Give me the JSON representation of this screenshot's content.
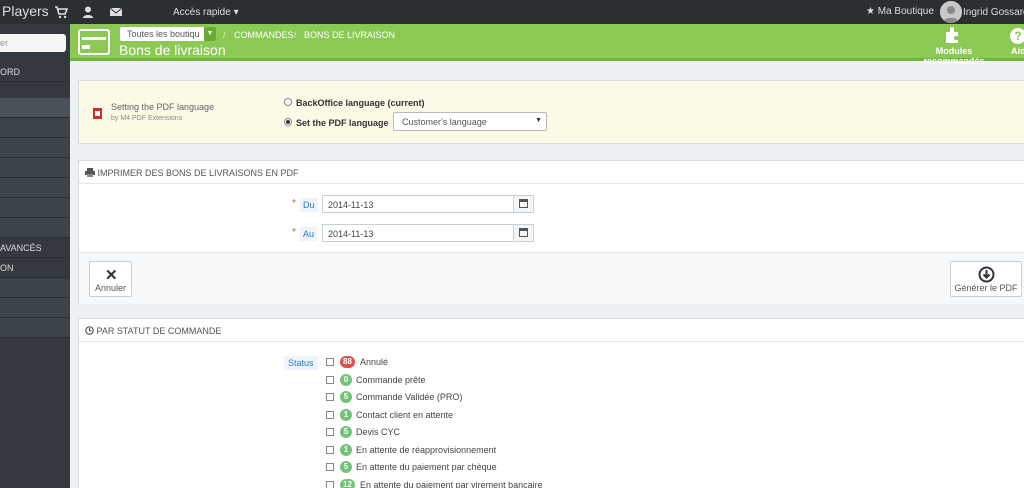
{
  "topbar": {
    "brand": "Players",
    "icons": [
      "cart-icon",
      "user-icon",
      "envelope-icon"
    ],
    "quick_access": "Accès rapide ▾",
    "shop": "★ Ma Boutique",
    "user": "Ingrid Gossard"
  },
  "sidebar": {
    "search_placeholder": "er",
    "items": [
      {
        "label": "ORD",
        "active": false
      },
      {
        "label": "",
        "active": true
      },
      {
        "label": "",
        "active": false
      },
      {
        "label": "",
        "active": false
      },
      {
        "label": "",
        "active": false
      },
      {
        "label": "",
        "active": false
      },
      {
        "label": "",
        "active": false
      },
      {
        "label": "",
        "active": false
      },
      {
        "label": "AVANCÉS",
        "active": false
      },
      {
        "label": "ON",
        "active": false
      },
      {
        "label": "",
        "active": false
      },
      {
        "label": "",
        "active": false
      },
      {
        "label": "",
        "active": false
      }
    ]
  },
  "header": {
    "shop_select": "Toutes les boutiqu",
    "breadcrumb": [
      "COMMANDES",
      "BONS DE LIVRAISON"
    ],
    "title": "Bons de livraison",
    "modules_label": "Modules recommandés",
    "help_label": "Aid"
  },
  "pdf_language": {
    "module_title": "Setting the PDF language",
    "module_by": "by M4 PDF Extensions",
    "option_backoffice": "BackOffice language (current)",
    "option_set": "Set the PDF language",
    "selected_option": "set",
    "language_select": "Customer's language"
  },
  "print_panel": {
    "heading": "IMPRIMER DES BONS DE LIVRAISONS EN PDF",
    "from_label": "Du",
    "from_value": "2014-11-13",
    "to_label": "Au",
    "to_value": "2014-11-13",
    "cancel_label": "Annuler",
    "generate_label": "Générer le PDF"
  },
  "status_panel": {
    "heading": "PAR STATUT DE COMMANDE",
    "status_tag": "Status",
    "colors": {
      "red": "#d9534f",
      "green": "#72c279"
    },
    "statuses": [
      {
        "count": "88",
        "label": "Annulé",
        "color": "red"
      },
      {
        "count": "0",
        "label": "Commande prête",
        "color": "green"
      },
      {
        "count": "5",
        "label": "Commande Validée (PRO)",
        "color": "green"
      },
      {
        "count": "1",
        "label": "Contact client en attente",
        "color": "green"
      },
      {
        "count": "5",
        "label": "Devis CYC",
        "color": "green"
      },
      {
        "count": "1",
        "label": "En attente de réapprovisionnement",
        "color": "green"
      },
      {
        "count": "5",
        "label": "En attente du paiement par chèque",
        "color": "green"
      },
      {
        "count": "12",
        "label": "En attente du paiement par virement bancaire",
        "color": "green"
      }
    ]
  }
}
